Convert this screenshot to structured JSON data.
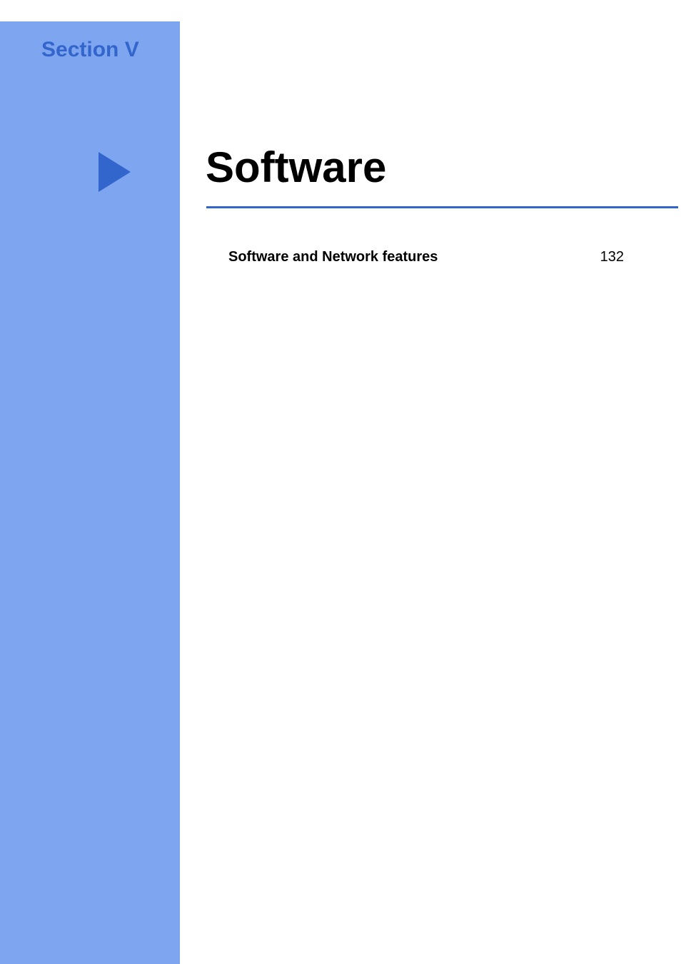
{
  "section_label": "Section V",
  "main_title": "Software",
  "toc": {
    "entry_title": "Software and Network features",
    "entry_page": "132"
  }
}
